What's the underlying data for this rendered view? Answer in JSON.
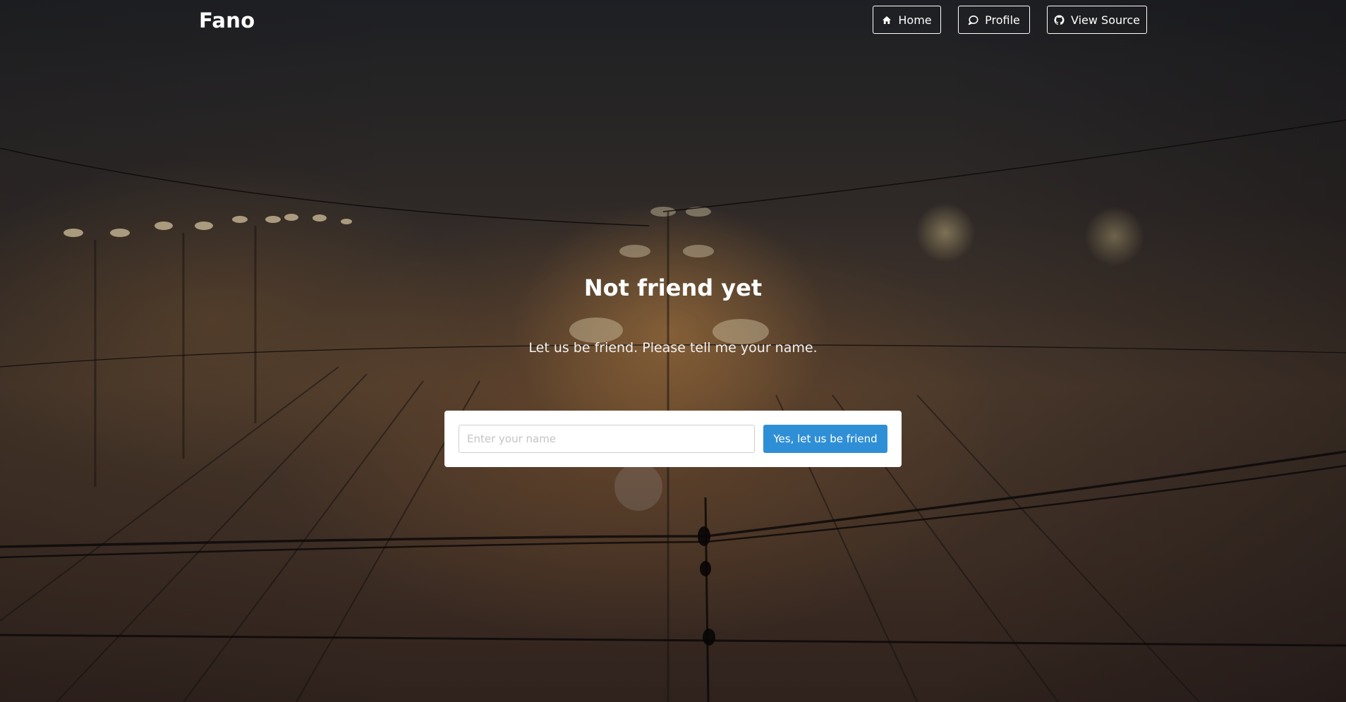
{
  "navbar": {
    "brand": "Fano",
    "links": [
      {
        "label": "Home",
        "icon": "home-icon"
      },
      {
        "label": "Profile",
        "icon": "comment-icon"
      },
      {
        "label": "View Source",
        "icon": "github-icon"
      }
    ]
  },
  "hero": {
    "title": "Not friend yet",
    "subtitle": "Let us be friend. Please tell me your name."
  },
  "form": {
    "placeholder": "Enter your name",
    "submit_label": "Yes, let us be friend"
  },
  "colors": {
    "button_primary": "#2f8fd6",
    "text": "#ffffff"
  }
}
